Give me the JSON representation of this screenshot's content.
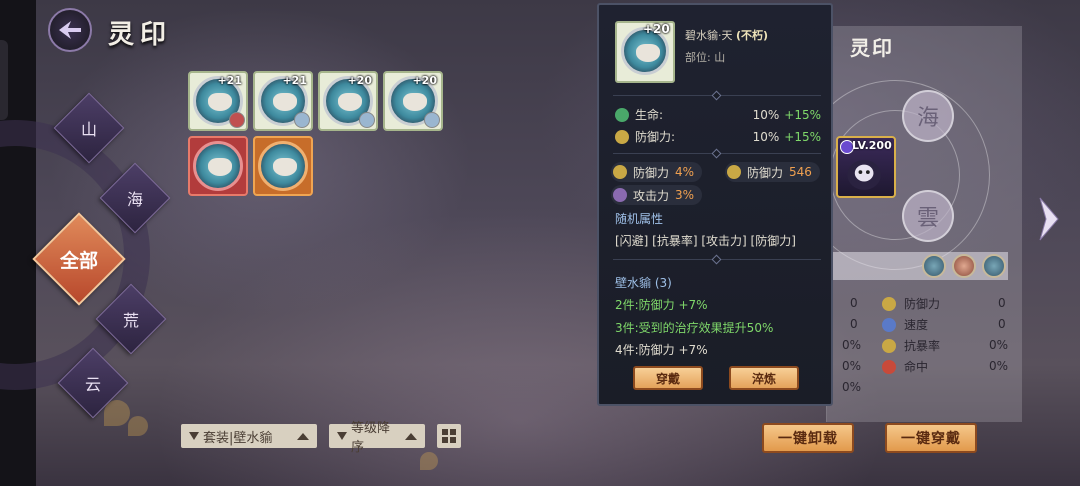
{
  "header": {
    "title": "灵印"
  },
  "categories": {
    "items": [
      {
        "label": "山"
      },
      {
        "label": "海"
      },
      {
        "label": "全部",
        "active": true
      },
      {
        "label": "荒"
      },
      {
        "label": "云"
      }
    ]
  },
  "seals": [
    {
      "level": "+21",
      "frame": "white"
    },
    {
      "level": "+21",
      "frame": "white"
    },
    {
      "level": "+20",
      "frame": "white"
    },
    {
      "level": "+20",
      "frame": "white"
    },
    {
      "level": "",
      "frame": "red"
    },
    {
      "level": "",
      "frame": "orange"
    }
  ],
  "filters": {
    "set_filter": "套装|壁水貐",
    "sort_filter": "等级降序"
  },
  "right_panel": {
    "title": "灵印",
    "slots": [
      {
        "label": "海"
      },
      {
        "label": "雲"
      }
    ],
    "character_level": "LV.200",
    "stats": [
      {
        "name": "防御力",
        "value": "0",
        "left_value": "0",
        "color": "#c9a845"
      },
      {
        "name": "速度",
        "value": "0",
        "left_value": "0",
        "color": "#5a7ac8"
      },
      {
        "name": "抗暴率",
        "value": "0%",
        "left_value": "0%",
        "color": "#c9a845"
      },
      {
        "name": "命中",
        "value": "0%",
        "left_value": "0%",
        "color": "#c84a3a"
      }
    ],
    "extra_left_value": "0%"
  },
  "actions": {
    "unequip_all": "一键卸载",
    "equip_all": "一键穿戴"
  },
  "tooltip": {
    "level": "+20",
    "name": "碧水貐·天",
    "quality": "(不朽)",
    "position": "部位: 山",
    "main_stats": [
      {
        "name": "生命:",
        "value": "10%",
        "bonus": "+15%",
        "color": "#4aa86a"
      },
      {
        "name": "防御力:",
        "value": "10%",
        "bonus": "+15%",
        "color": "#c9a845"
      }
    ],
    "sub_stats": [
      {
        "name": "防御力",
        "value": "4%"
      },
      {
        "name": "防御力",
        "value": "546"
      },
      {
        "name": "攻击力",
        "value": "3%"
      }
    ],
    "random_title": "随机属性",
    "random_attrs": "[闪避] [抗暴率] [攻击力] [防御力]",
    "set_name": "壁水貐 (3)",
    "set_bonus_2": "2件:防御力 +7%",
    "set_bonus_3": "3件:受到的治疗效果提升50%",
    "set_bonus_4_label": "4件:防御力 ",
    "set_bonus_4_value": "+7%",
    "equip_button": "穿戴",
    "refine_button": "淬炼"
  },
  "colors": {
    "accent_orange": "#e29a4c",
    "gain_green": "#7fd86a",
    "sub_orange": "#f0a050"
  }
}
